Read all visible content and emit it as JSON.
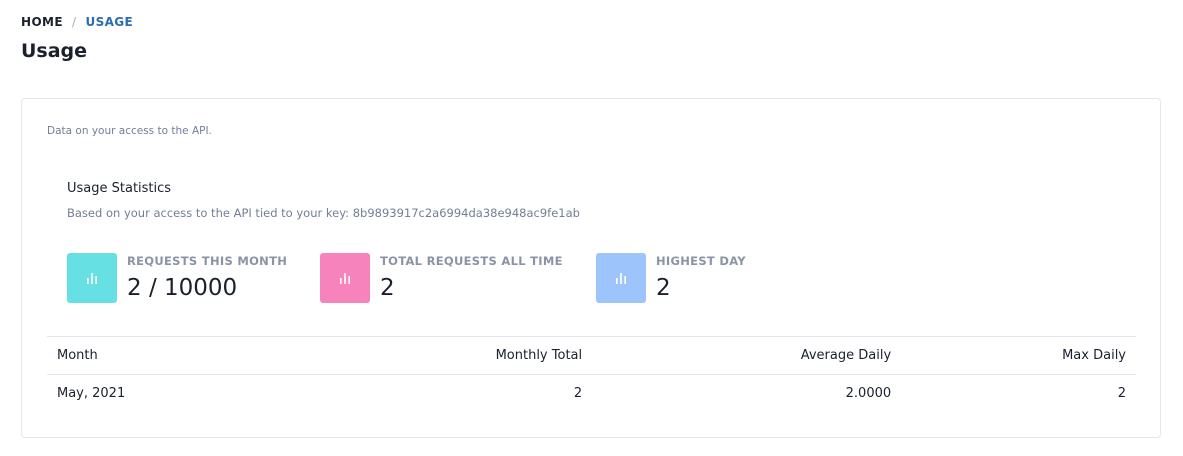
{
  "breadcrumb": {
    "home": "HOME",
    "separator": "/",
    "current": "USAGE"
  },
  "page_title": "Usage",
  "card": {
    "description": "Data on your access to the API.",
    "stats_title": "Usage Statistics",
    "stats_subtitle": "Based on your access to the API tied to your key: 8b9893917c2a6994da38e948ac9fe1ab"
  },
  "stats": [
    {
      "label": "REQUESTS THIS MONTH",
      "value": "2 / 10000",
      "icon": "bar-chart-icon",
      "color": "#67e0e3"
    },
    {
      "label": "TOTAL REQUESTS ALL TIME",
      "value": "2",
      "icon": "bar-chart-icon",
      "color": "#f783bc"
    },
    {
      "label": "HIGHEST DAY",
      "value": "2",
      "icon": "bar-chart-icon",
      "color": "#9ec5fb"
    }
  ],
  "table": {
    "headers": [
      "Month",
      "Monthly Total",
      "Average Daily",
      "Max Daily"
    ],
    "rows": [
      [
        "May, 2021",
        "2",
        "2.0000",
        "2"
      ]
    ]
  }
}
